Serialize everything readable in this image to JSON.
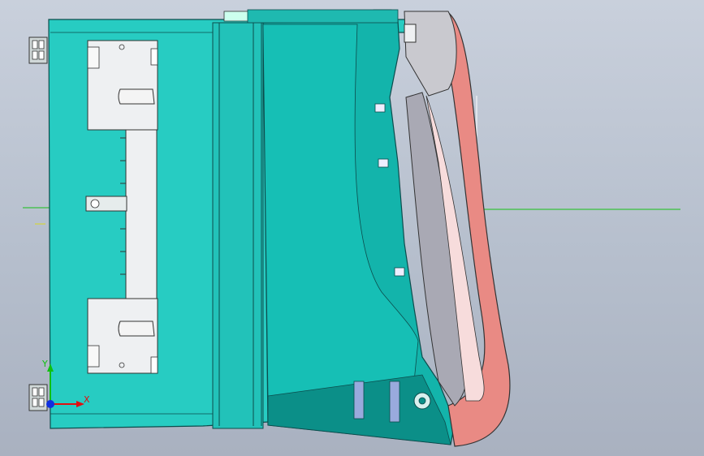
{
  "viewport": {
    "background_top": "#c9d0dc",
    "background_bottom": "#a9b1c0"
  },
  "model": {
    "body_color": "#23c8bf",
    "body_dark": "#10a8a0",
    "handle_color": "#e98a84",
    "clip_color": "#eef0f2",
    "edge_color": "#0c4c4c"
  },
  "reference_lines": {
    "color": "#17c017"
  },
  "triad": {
    "x_label": "X",
    "y_label": "Y",
    "x_color": "#e01010",
    "y_color": "#10c010",
    "z_color": "#1030e0"
  }
}
